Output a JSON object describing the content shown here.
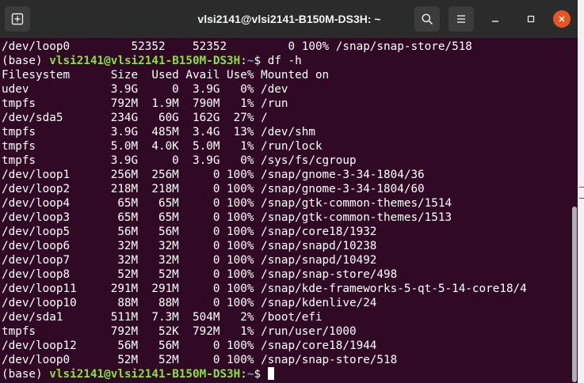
{
  "window": {
    "title": "vlsi2141@vlsi2141-B150M-DS3H: ~"
  },
  "colors": {
    "terminal_bg": "#300a24",
    "titlebar_bg": "#2b2b2b",
    "prompt_user": "#8ae234",
    "prompt_path": "#729fcf",
    "close_button": "#e95420"
  },
  "icons": {
    "new_tab": "new-tab-icon",
    "search": "search-icon",
    "menu": "hamburger-menu-icon",
    "minimize": "minimize-icon",
    "maximize": "maximize-icon",
    "close": "close-icon"
  },
  "terminal": {
    "top_line": "/dev/loop0         52352    52352         0 100% /snap/snap-store/518",
    "prompt1": {
      "env": "(base) ",
      "user_host": "vlsi2141@vlsi2141-B150M-DS3H",
      "sep": ":",
      "path": "~",
      "symbol": "$ ",
      "command": "df -h"
    },
    "header": "Filesystem      Size  Used Avail Use% Mounted on",
    "rows": [
      "udev            3.9G     0  3.9G   0% /dev",
      "tmpfs           792M  1.9M  790M   1% /run",
      "/dev/sda5       234G   60G  162G  27% /",
      "tmpfs           3.9G  485M  3.4G  13% /dev/shm",
      "tmpfs           5.0M  4.0K  5.0M   1% /run/lock",
      "tmpfs           3.9G     0  3.9G   0% /sys/fs/cgroup",
      "/dev/loop1      256M  256M     0 100% /snap/gnome-3-34-1804/36",
      "/dev/loop2      218M  218M     0 100% /snap/gnome-3-34-1804/60",
      "/dev/loop4       65M   65M     0 100% /snap/gtk-common-themes/1514",
      "/dev/loop3       65M   65M     0 100% /snap/gtk-common-themes/1513",
      "/dev/loop5       56M   56M     0 100% /snap/core18/1932",
      "/dev/loop6       32M   32M     0 100% /snap/snapd/10238",
      "/dev/loop7       32M   32M     0 100% /snap/snapd/10492",
      "/dev/loop8       52M   52M     0 100% /snap/snap-store/498",
      "/dev/loop11     291M  291M     0 100% /snap/kde-frameworks-5-qt-5-14-core18/4",
      "/dev/loop10      88M   88M     0 100% /snap/kdenlive/24",
      "/dev/sda1       511M  7.3M  504M   2% /boot/efi",
      "tmpfs           792M   52K  792M   1% /run/user/1000",
      "/dev/loop12      56M   56M     0 100% /snap/core18/1944",
      "/dev/loop0       52M   52M     0 100% /snap/snap-store/518"
    ],
    "prompt2": {
      "env": "(base) ",
      "user_host": "vlsi2141@vlsi2141-B150M-DS3H",
      "sep": ":",
      "path": "~",
      "symbol": "$ "
    }
  }
}
